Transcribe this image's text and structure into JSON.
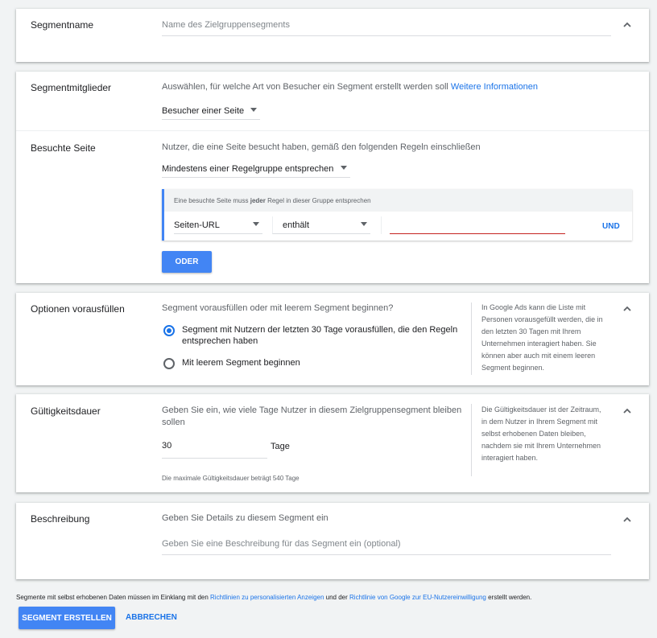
{
  "colors": {
    "accent": "#4285f4",
    "link": "#1a73e8",
    "error_underline": "#c5221f",
    "background": "#f1f3f4"
  },
  "segment_name": {
    "label": "Segmentname",
    "placeholder": "Name des Zielgruppensegments"
  },
  "members": {
    "label": "Segmentmitglieder",
    "description": "Auswählen, für welche Art von Besucher ein Segment erstellt werden soll",
    "more_info": "Weitere Informationen",
    "selected": "Besucher einer Seite"
  },
  "visited_page": {
    "label": "Besuchte Seite",
    "description": "Nutzer, die eine Seite besucht haben, gemäß den folgenden Regeln einschließen",
    "match_selected": "Mindestens einer Regelgruppe entsprechen",
    "rule_group": {
      "header_prefix": "Eine besuchte Seite muss ",
      "header_bold": "jeder",
      "header_suffix": " Regel in dieser Gruppe entsprechen",
      "field": "Seiten-URL",
      "operator": "enthält",
      "value": "",
      "and_label": "UND"
    },
    "or_button": "ODER"
  },
  "prefill": {
    "label": "Optionen vorausfüllen",
    "question": "Segment vorausfüllen oder mit leerem Segment beginnen?",
    "option_1": "Segment mit Nutzern der letzten 30 Tage vorausfüllen, die den Regeln entsprechen haben",
    "option_2": "Mit leerem Segment beginnen",
    "selected_option": 1,
    "side_note": "In Google Ads kann die Liste mit Personen vorausgefüllt werden, die in den letzten 30 Tagen mit Ihrem Unternehmen interagiert haben. Sie können aber auch mit einem leeren Segment beginnen."
  },
  "duration": {
    "label": "Gültigkeitsdauer",
    "description": "Geben Sie ein, wie viele Tage Nutzer in diesem Zielgruppensegment bleiben sollen",
    "value": "30",
    "unit": "Tage",
    "max_hint": "Die maximale Gültigkeitsdauer beträgt 540 Tage",
    "side_note": "Die Gültigkeitsdauer ist der Zeitraum, in dem Nutzer in Ihrem Segment mit selbst erhobenen Daten bleiben, nachdem sie mit Ihrem Unternehmen interagiert haben."
  },
  "description": {
    "label": "Beschreibung",
    "intro": "Geben Sie Details zu diesem Segment ein",
    "placeholder": "Geben Sie eine Beschreibung für das Segment ein (optional)"
  },
  "footer": {
    "policy_text_1": "Segmente mit selbst erhobenen Daten müssen im Einklang mit den ",
    "policy_link_1": "Richtlinien zu personalisierten Anzeigen",
    "policy_text_2": " und der ",
    "policy_link_2": "Richtlinie von Google zur EU-Nutzereinwilligung",
    "policy_text_3": " erstellt werden.",
    "create_button": "SEGMENT ERSTELLEN",
    "cancel_button": "ABBRECHEN"
  }
}
